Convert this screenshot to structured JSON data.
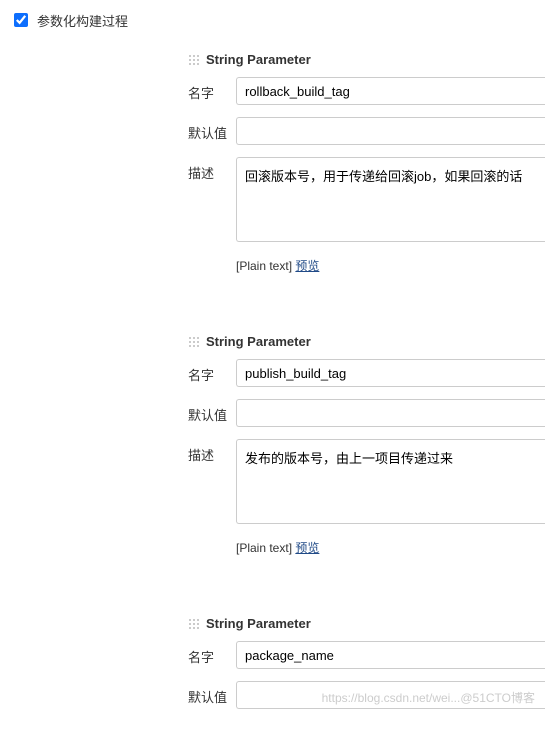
{
  "checkbox": {
    "label": "参数化构建过程",
    "checked": true
  },
  "labels": {
    "name": "名字",
    "default": "默认值",
    "description": "描述",
    "plainText": "[Plain text]",
    "preview": "预览"
  },
  "params": [
    {
      "type": "String Parameter",
      "name": "rollback_build_tag",
      "default": "",
      "description": "回滚版本号，用于传递给回滚job，如果回滚的话"
    },
    {
      "type": "String Parameter",
      "name": "publish_build_tag",
      "default": "",
      "description": "发布的版本号，由上一项目传递过来"
    },
    {
      "type": "String Parameter",
      "name": "package_name",
      "default": "",
      "description": ""
    }
  ],
  "watermark": "https://blog.csdn.net/wei...@51CTO博客"
}
